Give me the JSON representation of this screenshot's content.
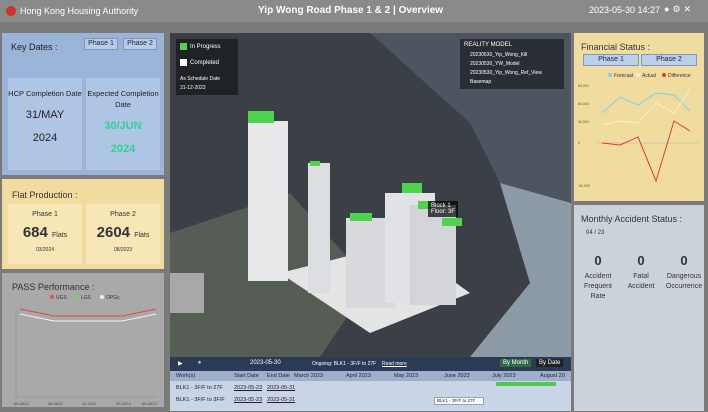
{
  "header": {
    "org": "Hong Kong Housing Authority",
    "title": "Yip Wong Road Phase 1 & 2 | Overview",
    "datetime": "2023-05-30 14:27"
  },
  "key_dates": {
    "title": "Key Dates :",
    "phase_buttons": [
      "Phase 1",
      "Phase 2"
    ],
    "hcp": {
      "label": "HCP Completion Date",
      "date": "31/MAY",
      "year": "2024"
    },
    "expected": {
      "label": "Expected Completion Date",
      "date": "30/JUN",
      "year": "2024"
    }
  },
  "flat_production": {
    "title": "Flat Production :",
    "phase1": {
      "label": "Phase 1",
      "value": "684",
      "unit": "Flats",
      "date": "03/2024"
    },
    "phase2": {
      "label": "Phase 2",
      "value": "2604",
      "unit": "Flats",
      "date": "08/2023"
    }
  },
  "pass": {
    "title": "PASS Performance :",
    "legend": [
      "UGS",
      "LGS",
      "OPGc"
    ],
    "x_labels": [
      "05-2022",
      "08-2022",
      "11-2022",
      "02-2023",
      "05-2023"
    ]
  },
  "map": {
    "legend": {
      "in_progress": "In Progress",
      "completed": "Completed",
      "date_label": "As Schedule Date",
      "date": "31-12-2023"
    },
    "layers": {
      "title": "REALITY MODEL",
      "items": [
        "20230530_Yip_Wong_Kill",
        "20230530_YW_Model",
        "20230530_Yip_Wong_Ref_View",
        "Basemap"
      ]
    },
    "tooltip": {
      "block": "Block 1",
      "floor": "Floor: 3F"
    },
    "playback": {
      "date": "2023-05-30",
      "ongoing": "Ongoing: BLK1 - 3F/F to 27F",
      "read_more": "Read more",
      "by_month": "By Month",
      "by_date": "By Date"
    },
    "gantt": {
      "headers": [
        "Work(s)",
        "Start Date",
        "End Date"
      ],
      "months": [
        "March 2023",
        "April 2023",
        "May 2023",
        "June 2023",
        "July 2023",
        "August 20"
      ],
      "rows": [
        [
          "BLK1 - 3F/F to 27F",
          "2023-05-23",
          "2023-05-31"
        ],
        [
          "BLK1 - 3F/F to 3F/F",
          "2023-05-23",
          "2023-05-31"
        ]
      ],
      "bar_label": "BLK1 - 3F/F to 27F"
    }
  },
  "financial": {
    "title": "Financial Status :",
    "phase_buttons": [
      "Phase 1",
      "Phase 2"
    ],
    "legend": [
      "Forecast",
      "Actual",
      "Difference"
    ],
    "y_labels": [
      "80,000",
      "60,000",
      "40,000",
      "20,000",
      "0",
      "-20,000",
      "-40,000",
      "-60,000"
    ]
  },
  "accident": {
    "title": "Monthly Accident Status :",
    "month": "04 / 23",
    "stats": [
      {
        "value": "0",
        "label": "Accident Frequent Rate"
      },
      {
        "value": "0",
        "label": "Fatal Accident"
      },
      {
        "value": "0",
        "label": "Dangerous Occurrence"
      }
    ]
  },
  "colors": {
    "key_dates_bg": "#9ab4d8",
    "accent_green": "#2fd39a",
    "flat_bg": "#f1dca0",
    "pass_bg": "#a9a9a9",
    "map_bg": "#2d3338",
    "forecast": "#7ed0f0",
    "actual": "#f3e6a0",
    "difference": "#e03a3a"
  }
}
